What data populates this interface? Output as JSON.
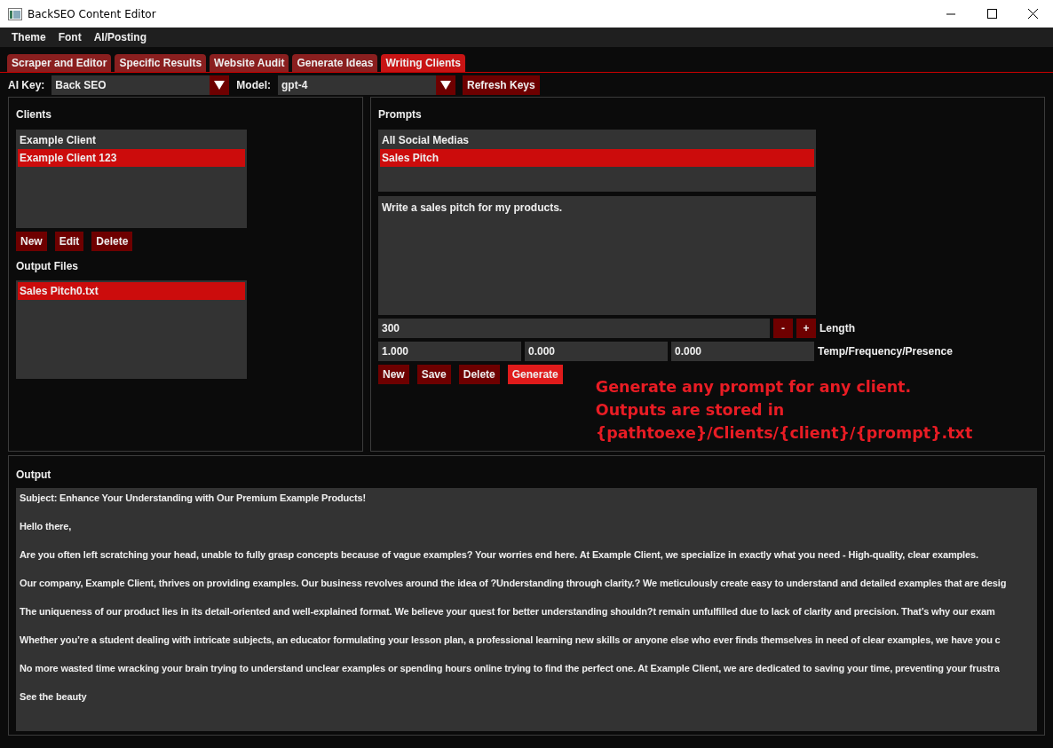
{
  "window": {
    "title": "BackSEO Content Editor"
  },
  "menu": [
    "Theme",
    "Font",
    "AI/Posting"
  ],
  "tabs": [
    {
      "label": "Scraper and Editor",
      "selected": false
    },
    {
      "label": "Specific Results",
      "selected": false
    },
    {
      "label": "Website Audit",
      "selected": false
    },
    {
      "label": "Generate Ideas",
      "selected": false
    },
    {
      "label": "Writing Clients",
      "selected": true
    }
  ],
  "toolbar": {
    "ai_key_label": "AI Key:",
    "ai_key": "Back SEO",
    "model_label": "Model:",
    "model": "gpt-4",
    "refresh_button": "Refresh Keys"
  },
  "clients_panel": {
    "title": "Clients",
    "items": [
      {
        "label": "Example Client",
        "selected": false
      },
      {
        "label": "Example Client 123",
        "selected": true
      }
    ],
    "buttons": [
      "New",
      "Edit",
      "Delete"
    ],
    "output_files_title": "Output Files",
    "output_files": [
      {
        "label": "Sales Pitch0.txt",
        "selected": true
      }
    ]
  },
  "prompts_panel": {
    "title": "Prompts",
    "items": [
      {
        "label": "All Social Medias",
        "selected": false
      },
      {
        "label": "Sales Pitch",
        "selected": true
      }
    ],
    "prompt_text": "Write a sales pitch for my products.",
    "length": "300",
    "decrement": "-",
    "increment": "+",
    "length_label": "Length",
    "params": [
      "1.000",
      "0.000",
      "0.000"
    ],
    "params_label": "Temp/Frequency/Presence",
    "buttons": [
      {
        "label": "New",
        "kind": "normal"
      },
      {
        "label": "Save",
        "kind": "normal"
      },
      {
        "label": "Delete",
        "kind": "normal"
      },
      {
        "label": "Generate",
        "kind": "accent"
      }
    ],
    "note": [
      "Generate any prompt for any client.",
      "Outputs are stored in",
      "{pathtoexe}/Clients/{client}/{prompt}.txt"
    ]
  },
  "output_panel": {
    "title": "Output",
    "lines": [
      "Subject: Enhance Your Understanding with Our Premium Example Products!",
      "Hello there,",
      "Are you often left scratching your head, unable to fully grasp concepts because of vague examples? Your worries end here. At Example Client, we specialize in exactly what you need - High-quality, clear examples.",
      "Our company, Example Client, thrives on providing examples. Our business revolves around the idea of ?Understanding through clarity.? We meticulously create easy to understand and detailed examples that are desig",
      "The uniqueness of our product lies in its detail-oriented and well-explained format. We believe your quest for better understanding shouldn?t remain unfulfilled due to lack of clarity and precision. That’s why our exam",
      "Whether you’re a student dealing with intricate subjects, an educator formulating your lesson plan, a professional learning new skills or anyone else who ever finds themselves in need of clear examples, we have you c",
      "No more wasted time wracking your brain trying to understand unclear examples or spending hours online trying to find the perfect one. At Example Client, we are dedicated to saving your time, preventing your frustra",
      "See the beauty"
    ]
  }
}
